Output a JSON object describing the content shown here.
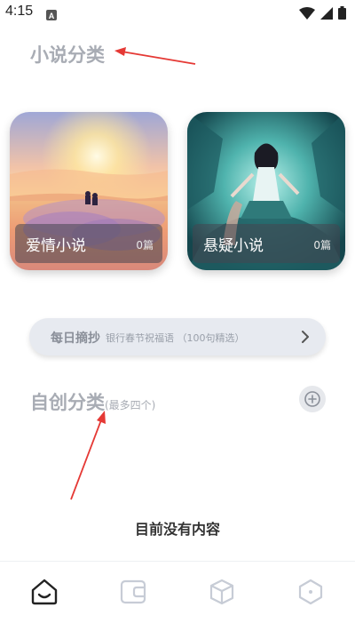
{
  "status_bar": {
    "time": "4:15",
    "notification_icon": "a-square-icon",
    "icons": [
      "wifi-icon",
      "signal-icon",
      "battery-icon"
    ]
  },
  "novel_section": {
    "title": "小说分类"
  },
  "categories": [
    {
      "label": "爱情小说",
      "count": "0篇",
      "art": "sunset-beach-couple"
    },
    {
      "label": "悬疑小说",
      "count": "0篇",
      "art": "teal-girl-machinery"
    }
  ],
  "daily_excerpt": {
    "title": "每日摘抄",
    "text": "银行春节祝福语 （100句精选）",
    "chevron": "chevron-right-icon"
  },
  "custom_section": {
    "title": "自创分类",
    "note": "(最多四个)",
    "add_icon": "plus-circle-icon"
  },
  "empty_message": "目前没有内容",
  "tabs": [
    {
      "name": "home-tab",
      "icon": "smile-house-icon",
      "active": true
    },
    {
      "name": "wallet-tab",
      "icon": "wallet-icon",
      "active": false
    },
    {
      "name": "cube-tab",
      "icon": "cube-icon",
      "active": false
    },
    {
      "name": "hexagon-tab",
      "icon": "hexagon-icon",
      "active": false
    }
  ],
  "colors": {
    "annotation_arrow": "#e53935",
    "section_title": "#a8acb4",
    "inactive_tab": "#c7ccd6",
    "active_tab": "#222222"
  }
}
